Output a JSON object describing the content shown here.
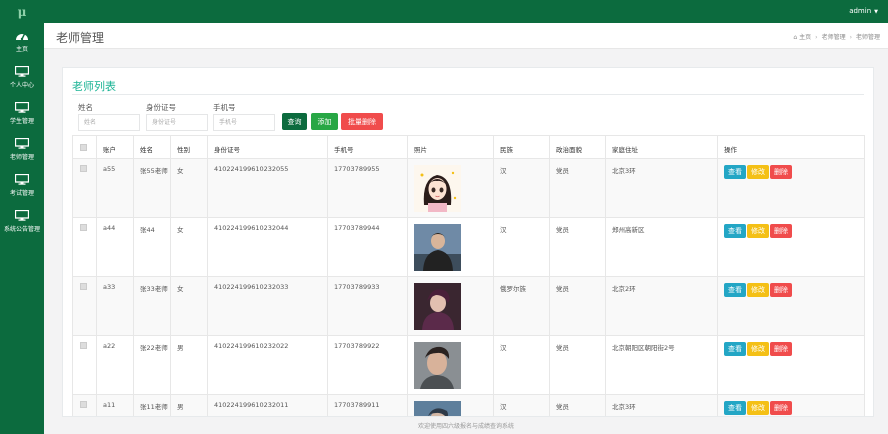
{
  "app": {
    "logo_text": "μ"
  },
  "topbar": {
    "user": "admin"
  },
  "sidebar": {
    "items": [
      {
        "label": "主页",
        "icon": "dashboard-icon"
      },
      {
        "label": "个人中心",
        "icon": "monitor-icon"
      },
      {
        "label": "学生管理",
        "icon": "monitor-icon"
      },
      {
        "label": "老师管理",
        "icon": "monitor-icon"
      },
      {
        "label": "考试管理",
        "icon": "monitor-icon"
      },
      {
        "label": "系统公告管理",
        "icon": "monitor-icon"
      }
    ]
  },
  "header": {
    "title": "老师管理",
    "breadcrumb": [
      "主页",
      "老师管理",
      "老师管理"
    ]
  },
  "card": {
    "title": "老师列表"
  },
  "filters": {
    "name": {
      "label": "姓名",
      "placeholder": "姓名"
    },
    "idcard": {
      "label": "身份证号",
      "placeholder": "身份证号"
    },
    "phone": {
      "label": "手机号",
      "placeholder": "手机号"
    }
  },
  "buttons": {
    "query": "查询",
    "add": "添加",
    "bulk_delete": "批量删除"
  },
  "table": {
    "headers": [
      "账户",
      "姓名",
      "性别",
      "身份证号",
      "手机号",
      "照片",
      "民族",
      "政治面貌",
      "家庭住址",
      "操作"
    ],
    "actions": {
      "view": "查看",
      "edit": "修改",
      "delete": "删除"
    },
    "rows": [
      {
        "account": "a55",
        "name": "张55老师",
        "gender": "女",
        "idcard": "410224199610232055",
        "phone": "17703789955",
        "photo": "anime-girl",
        "ethnicity": "汉",
        "political": "党员",
        "address": "北京3环"
      },
      {
        "account": "a44",
        "name": "张44",
        "gender": "女",
        "idcard": "410224199610232044",
        "phone": "17703789944",
        "photo": "man-dark-jacket",
        "ethnicity": "汉",
        "political": "党员",
        "address": "郑州高新区"
      },
      {
        "account": "a33",
        "name": "张33老师",
        "gender": "女",
        "idcard": "410224199610232033",
        "phone": "17703789933",
        "photo": "man-purple",
        "ethnicity": "俄罗尔族",
        "political": "党员",
        "address": "北京2环"
      },
      {
        "account": "a22",
        "name": "张22老师",
        "gender": "男",
        "idcard": "410224199610232022",
        "phone": "17703789922",
        "photo": "man-portrait",
        "ethnicity": "汉",
        "political": "党员",
        "address": "北京朝阳区朝阳街2号"
      },
      {
        "account": "a11",
        "name": "张11老师",
        "gender": "男",
        "idcard": "410224199610232011",
        "phone": "17703789911",
        "photo": "man-blue",
        "ethnicity": "汉",
        "political": "党员",
        "address": "北京3环"
      }
    ]
  },
  "footer": {
    "text": "欢迎使用四六级报名与成绩查询系统"
  },
  "colors": {
    "primary": "#0c6b3e",
    "accent": "#1ab394",
    "add": "#28a745",
    "danger": "#f04c4c",
    "info": "#23a6c5",
    "warning": "#f4c016"
  }
}
